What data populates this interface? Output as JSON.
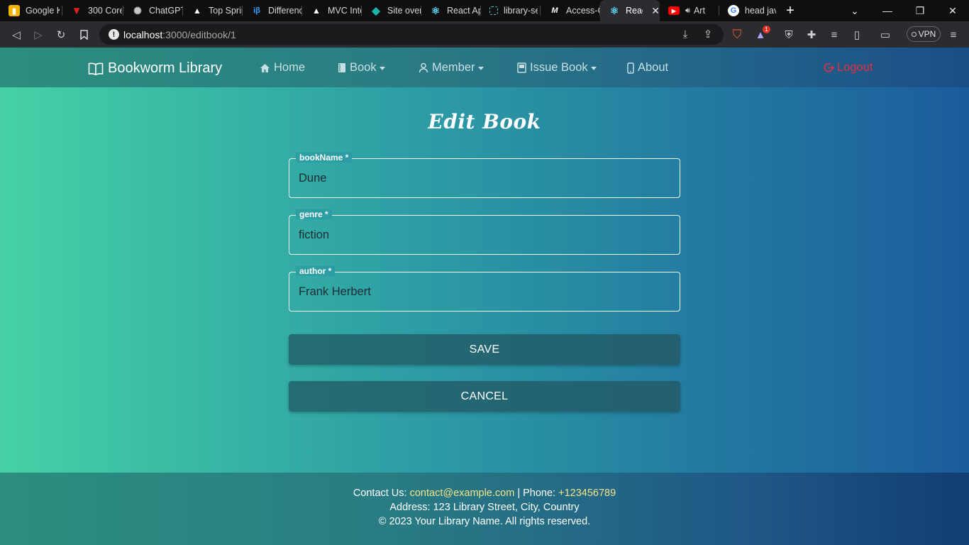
{
  "browser": {
    "tabs": [
      {
        "label": "Google K",
        "icon": "google-keep-icon",
        "color": "#f4b400"
      },
      {
        "label": "300 Core",
        "icon": "v-logo-icon",
        "color": "#e0201e"
      },
      {
        "label": "ChatGPT",
        "icon": "chatgpt-icon",
        "color": "#c8c8c8"
      },
      {
        "label": "Top Sprin",
        "icon": "baeldung-icon",
        "color": "#ffffff"
      },
      {
        "label": "Differenc",
        "icon": "ib-icon",
        "color": "#3aa0ff"
      },
      {
        "label": "MVC Inte",
        "icon": "baeldung-icon",
        "color": "#ffffff"
      },
      {
        "label": "Site over",
        "icon": "diamond-icon",
        "color": "#1bb4a8"
      },
      {
        "label": "React Ap",
        "icon": "react-icon",
        "color": "#5ed3f3"
      },
      {
        "label": "library-se",
        "icon": "codesandbox-icon",
        "color": "#3fd6c8"
      },
      {
        "label": "Access-C",
        "icon": "mdn-icon",
        "color": "#ffffff"
      },
      {
        "label": "React",
        "icon": "react-icon",
        "color": "#5ed3f3",
        "active": true
      },
      {
        "label": "Art M",
        "icon": "youtube-icon",
        "color": "#ff0000"
      },
      {
        "label": "head java",
        "icon": "google-icon",
        "color": "#4285f4"
      }
    ],
    "url_host": "localhost",
    "url_path": ":3000/editbook/1",
    "vpn_label": "VPN",
    "notification_count": "1"
  },
  "navbar": {
    "brand": "Bookworm Library",
    "items": [
      {
        "label": "Home",
        "icon": "home-icon",
        "dropdown": false
      },
      {
        "label": "Book",
        "icon": "book-icon",
        "dropdown": true
      },
      {
        "label": "Member",
        "icon": "person-icon",
        "dropdown": true
      },
      {
        "label": "Issue Book",
        "icon": "journal-icon",
        "dropdown": true
      },
      {
        "label": "About",
        "icon": "phone-icon",
        "dropdown": false
      }
    ],
    "logout": "Logout"
  },
  "form": {
    "title": "Edit Book",
    "fields": [
      {
        "label": "bookName *",
        "value": "Dune"
      },
      {
        "label": "genre *",
        "value": "fiction"
      },
      {
        "label": "author *",
        "value": "Frank Herbert"
      }
    ],
    "save_label": "SAVE",
    "cancel_label": "CANCEL"
  },
  "footer": {
    "contact_prefix": "Contact Us:",
    "email": "contact@example.com",
    "phone_prefix": "| Phone:",
    "phone": "+123456789",
    "address": "Address: 123 Library Street, City, Country",
    "copyright": "© 2023 Your Library Name. All rights reserved."
  },
  "colors": {
    "navbar_link": "#c8dfe4",
    "logout": "#e2303c",
    "footer_highlight": "#f3e387",
    "button": "#246c73"
  }
}
